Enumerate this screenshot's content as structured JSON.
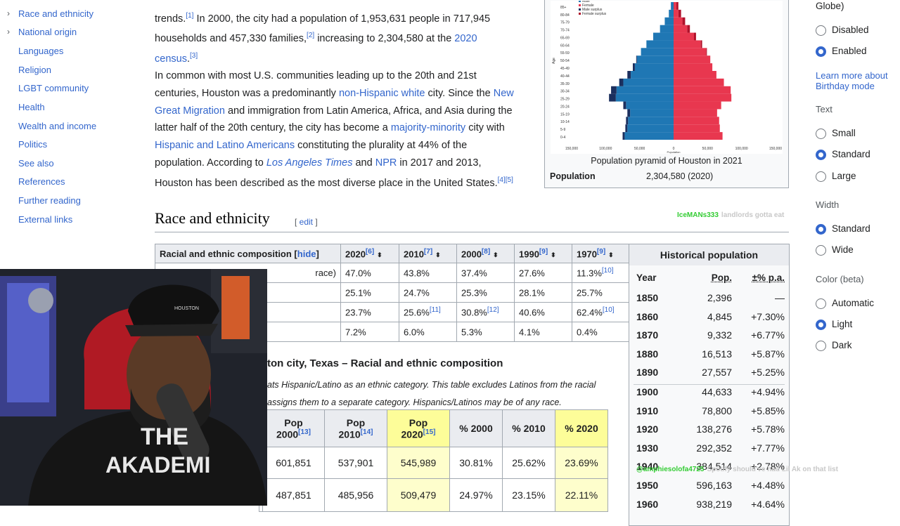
{
  "toc": {
    "items": [
      {
        "label": "Race and ethnicity",
        "expandable": true
      },
      {
        "label": "National origin",
        "expandable": true
      },
      {
        "label": "Languages",
        "expandable": false
      },
      {
        "label": "Religion",
        "expandable": false
      },
      {
        "label": "LGBT community",
        "expandable": false
      },
      {
        "label": "Health",
        "expandable": false
      },
      {
        "label": "Wealth and income",
        "expandable": false
      },
      {
        "label": "Politics",
        "expandable": false
      },
      {
        "label": "See also",
        "expandable": false
      },
      {
        "label": "References",
        "expandable": false
      },
      {
        "label": "Further reading",
        "expandable": false
      },
      {
        "label": "External links",
        "expandable": false
      }
    ]
  },
  "article": {
    "para1": {
      "line1": "trends.",
      "ref1": "[1]",
      "line1b": " In 2000, the city had a population of 1,953,631 people in 717,945",
      "line2a": "households and 457,330 families,",
      "ref2": "[2]",
      "line2b": " increasing to 2,304,580 at the ",
      "link2020": "2020",
      "link_census": "census",
      "ref3": "[3]"
    },
    "para2": {
      "t1": "In common with most U.S. communities leading up to the 20th and 21st",
      "t2": "centuries, Houston was a predominantly ",
      "l_nhw": "non-Hispanic white",
      "t3": " city. Since the ",
      "l_ngm1": "New",
      "l_ngm2": "Great Migration",
      "t4": " and immigration from Latin America, Africa, and Asia during the",
      "t5": "latter half of the 20th century, the city has become a ",
      "l_mm": "majority-minority",
      "t6": " city with",
      "l_hla": "Hispanic and Latino Americans",
      "t7": " constituting the plurality at 44% of the",
      "t8": "population. According to ",
      "l_lat": "Los Angeles Times",
      "t9": " and ",
      "l_npr": "NPR",
      "t10": " in 2017 and 2013,",
      "t11": "Houston has been described as the most diverse place in the United States.",
      "ref45": "[4][5]"
    },
    "section_title": "Race and ethnicity",
    "edit_label": "edit"
  },
  "infobox": {
    "caption": "Population pyramid of Houston in 2021",
    "pop_label": "Population",
    "pop_value": "2,304,580 (2020)",
    "pyramid": {
      "age_groups": [
        "0-4",
        "5-9",
        "10-14",
        "15-19",
        "20-24",
        "25-29",
        "30-34",
        "35-39",
        "40-44",
        "45-49",
        "50-54",
        "55-59",
        "60-64",
        "65-69",
        "70-74",
        "75-79",
        "80-84",
        "85+"
      ],
      "male": [
        75000,
        71000,
        70000,
        68000,
        74000,
        95000,
        92000,
        80000,
        68000,
        60000,
        55000,
        48000,
        40000,
        30000,
        20000,
        13000,
        7000,
        4000
      ],
      "female": [
        72000,
        68000,
        67000,
        64000,
        70000,
        85000,
        84000,
        74000,
        63000,
        57000,
        54000,
        49000,
        42000,
        33000,
        24000,
        17000,
        11000,
        7000
      ],
      "legend": [
        "Male",
        "Female",
        "Male surplus",
        "Female surplus"
      ],
      "x_ticks": [
        "150,000",
        "100,000",
        "50,000",
        "0",
        "50,000",
        "100,000",
        "150,000"
      ],
      "x_label": "Population",
      "y_label": "Age",
      "colors": {
        "male": "#1f77b4",
        "female": "#e8374f",
        "male_surplus": "#1b2f5e",
        "female_surplus": "#b0112a"
      }
    }
  },
  "race_table1": {
    "header_label": "Racial and ethnic composition",
    "hide_label": "hide",
    "years": [
      {
        "y": "2020",
        "ref": "[6]"
      },
      {
        "y": "2010",
        "ref": "[7]"
      },
      {
        "y": "2000",
        "ref": "[8]"
      },
      {
        "y": "1990",
        "ref": "[9]"
      },
      {
        "y": "1970",
        "ref": "[9]"
      }
    ],
    "rows": [
      {
        "label": "race)",
        "cells": [
          {
            "v": "47.0%",
            "r": ""
          },
          {
            "v": "43.8%",
            "r": ""
          },
          {
            "v": "37.4%",
            "r": ""
          },
          {
            "v": "27.6%",
            "r": ""
          },
          {
            "v": "11.3%",
            "r": "[10]"
          }
        ]
      },
      {
        "label": "",
        "cells": [
          {
            "v": "25.1%",
            "r": ""
          },
          {
            "v": "24.7%",
            "r": ""
          },
          {
            "v": "25.3%",
            "r": ""
          },
          {
            "v": "28.1%",
            "r": ""
          },
          {
            "v": "25.7%",
            "r": ""
          }
        ]
      },
      {
        "label": "",
        "cells": [
          {
            "v": "23.7%",
            "r": ""
          },
          {
            "v": "25.6%",
            "r": "[11]"
          },
          {
            "v": "30.8%",
            "r": "[12]"
          },
          {
            "v": "40.6%",
            "r": ""
          },
          {
            "v": "62.4%",
            "r": "[10]"
          }
        ]
      },
      {
        "label": "",
        "cells": [
          {
            "v": "7.2%",
            "r": ""
          },
          {
            "v": "6.0%",
            "r": ""
          },
          {
            "v": "5.3%",
            "r": ""
          },
          {
            "v": "4.1%",
            "r": ""
          },
          {
            "v": "0.4%",
            "r": ""
          }
        ]
      }
    ]
  },
  "race_table2": {
    "caption": "ton city, Texas – Racial and ethnic composition",
    "note1": "ats Hispanic/Latino as an ethnic category. This table excludes Latinos from the racial",
    "note2": "assigns them to a separate category. Hispanics/Latinos may be of any race.",
    "headers": [
      {
        "l1": "Pop",
        "l2": "2000",
        "ref": "[13]"
      },
      {
        "l1": "Pop",
        "l2": "2010",
        "ref": "[14]"
      },
      {
        "l1": "Pop",
        "l2": "2020",
        "ref": "[15]"
      },
      {
        "l1": "% 2000",
        "l2": "",
        "ref": ""
      },
      {
        "l1": "% 2010",
        "l2": "",
        "ref": ""
      },
      {
        "l1": "% 2020",
        "l2": "",
        "ref": ""
      }
    ],
    "rows": [
      [
        "601,851",
        "537,901",
        "545,989",
        "30.81%",
        "25.62%",
        "23.69%"
      ],
      [
        "487,851",
        "485,956",
        "509,479",
        "24.97%",
        "23.15%",
        "22.11%"
      ]
    ]
  },
  "historical_population": {
    "title": "Historical population",
    "col_year": "Year",
    "col_pop": "Pop.",
    "col_change": "±% p.a.",
    "rows": [
      {
        "year": "1850",
        "pop": "2,396",
        "chg": "—"
      },
      {
        "year": "1860",
        "pop": "4,845",
        "chg": "+7.30%"
      },
      {
        "year": "1870",
        "pop": "9,332",
        "chg": "+6.77%"
      },
      {
        "year": "1880",
        "pop": "16,513",
        "chg": "+5.87%"
      },
      {
        "year": "1890",
        "pop": "27,557",
        "chg": "+5.25%"
      },
      {
        "year": "1900",
        "pop": "44,633",
        "chg": "+4.94%"
      },
      {
        "year": "1910",
        "pop": "78,800",
        "chg": "+5.85%"
      },
      {
        "year": "1920",
        "pop": "138,276",
        "chg": "+5.78%"
      },
      {
        "year": "1930",
        "pop": "292,352",
        "chg": "+7.77%"
      },
      {
        "year": "1940",
        "pop": "384,514",
        "chg": "+2.78%"
      },
      {
        "year": "1950",
        "pop": "596,163",
        "chg": "+4.48%"
      },
      {
        "year": "1960",
        "pop": "938,219",
        "chg": "+4.64%"
      }
    ]
  },
  "settings": {
    "globe_tail": "Globe)",
    "birthday": [
      {
        "label": "Disabled",
        "on": false
      },
      {
        "label": "Enabled",
        "on": true
      }
    ],
    "birthday_link": [
      "Learn more about",
      "Birthday mode"
    ],
    "text_head": "Text",
    "text_opts": [
      {
        "label": "Small",
        "on": false
      },
      {
        "label": "Standard",
        "on": true
      },
      {
        "label": "Large",
        "on": false
      }
    ],
    "width_head": "Width",
    "width_opts": [
      {
        "label": "Standard",
        "on": true
      },
      {
        "label": "Wide",
        "on": false
      }
    ],
    "color_head": "Color (beta)",
    "color_opts": [
      {
        "label": "Automatic",
        "on": false
      },
      {
        "label": "Light",
        "on": true
      },
      {
        "label": "Dark",
        "on": false
      }
    ]
  },
  "chat": {
    "user1": "IceMANs333",
    "msg1": "landlords gotta eat",
    "user2": "@amphiesolofa4725",
    "msg2": "Spotify should've had Lil Ak on that list"
  },
  "webcam": {
    "shirt_text1": "THE",
    "shirt_text2": "AKADEMI",
    "cap_text": "HOUSTON"
  }
}
